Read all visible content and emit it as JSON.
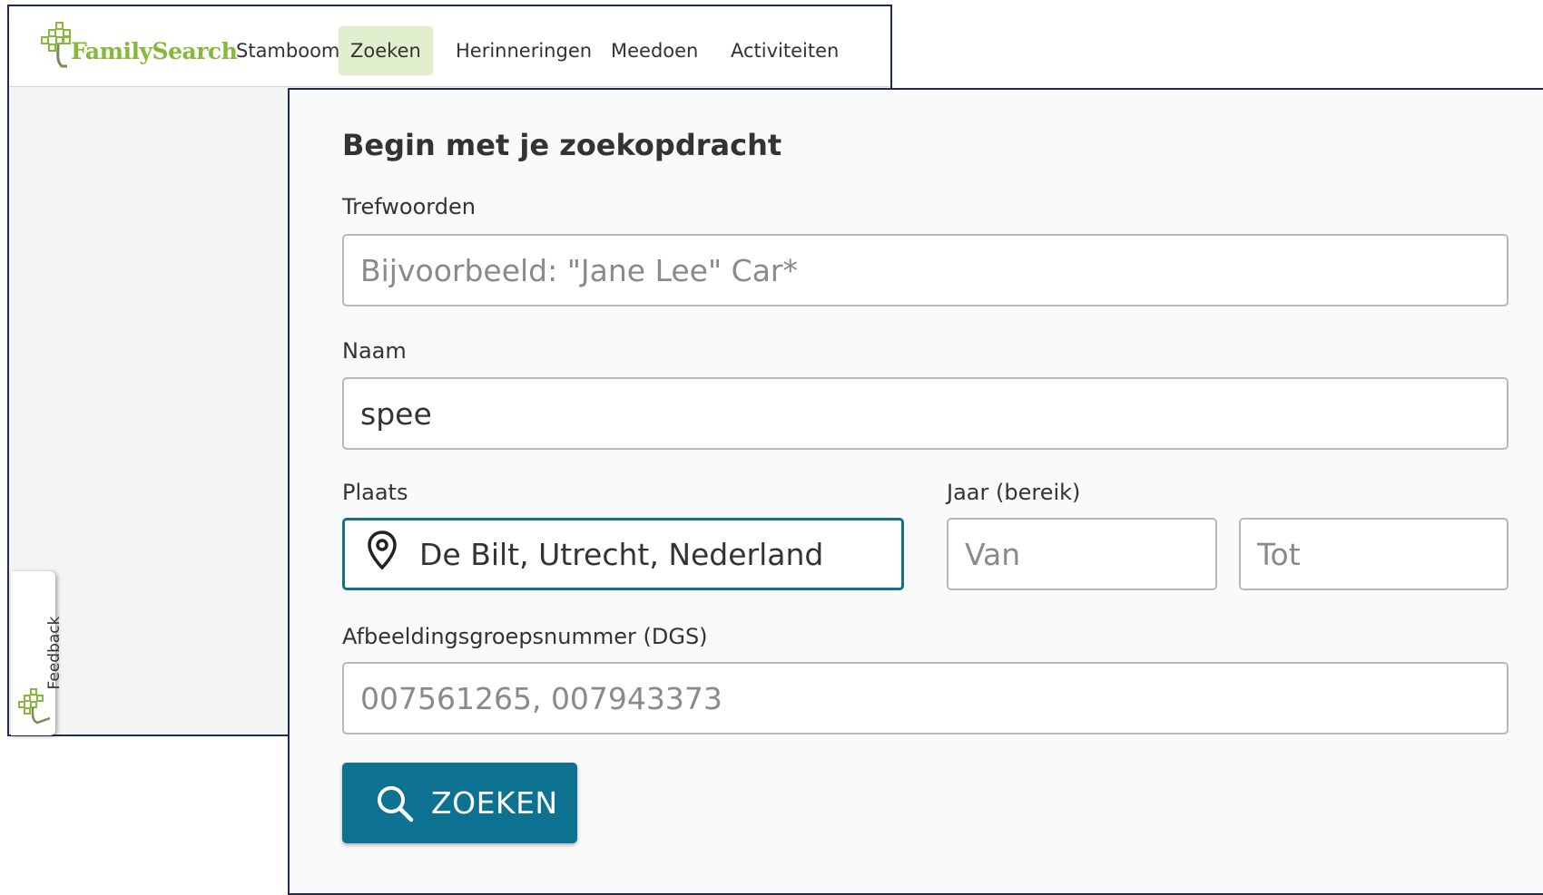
{
  "app": {
    "logo_text": "FamilySearch",
    "nav": [
      {
        "label": "Stamboom"
      },
      {
        "label": "Zoeken",
        "active": true
      },
      {
        "label": "Herinneringen"
      },
      {
        "label": "Meedoen"
      },
      {
        "label": "Activiteiten"
      }
    ],
    "feedback_label": "Feedback"
  },
  "search": {
    "title": "Begin met je zoekopdracht",
    "keywords": {
      "label": "Trefwoorden",
      "value": "",
      "placeholder": "Bijvoorbeeld: \"Jane Lee\" Car*"
    },
    "name": {
      "label": "Naam",
      "value": "spee"
    },
    "place": {
      "label": "Plaats",
      "value": "De Bilt, Utrecht, Nederland",
      "icon": "location-pin-icon"
    },
    "year": {
      "label": "Jaar (bereik)",
      "from_placeholder": "Van",
      "to_placeholder": "Tot"
    },
    "dgs": {
      "label": "Afbeeldingsgroepsnummer (DGS)",
      "placeholder": "007561265, 007943373"
    },
    "button_label": "ZOEKEN"
  },
  "colors": {
    "brand_green": "#86b83e",
    "active_nav_bg": "#e1efcf",
    "primary_button": "#0d7191",
    "focus_border": "#0d7191",
    "window_border": "#1f2a5c"
  }
}
